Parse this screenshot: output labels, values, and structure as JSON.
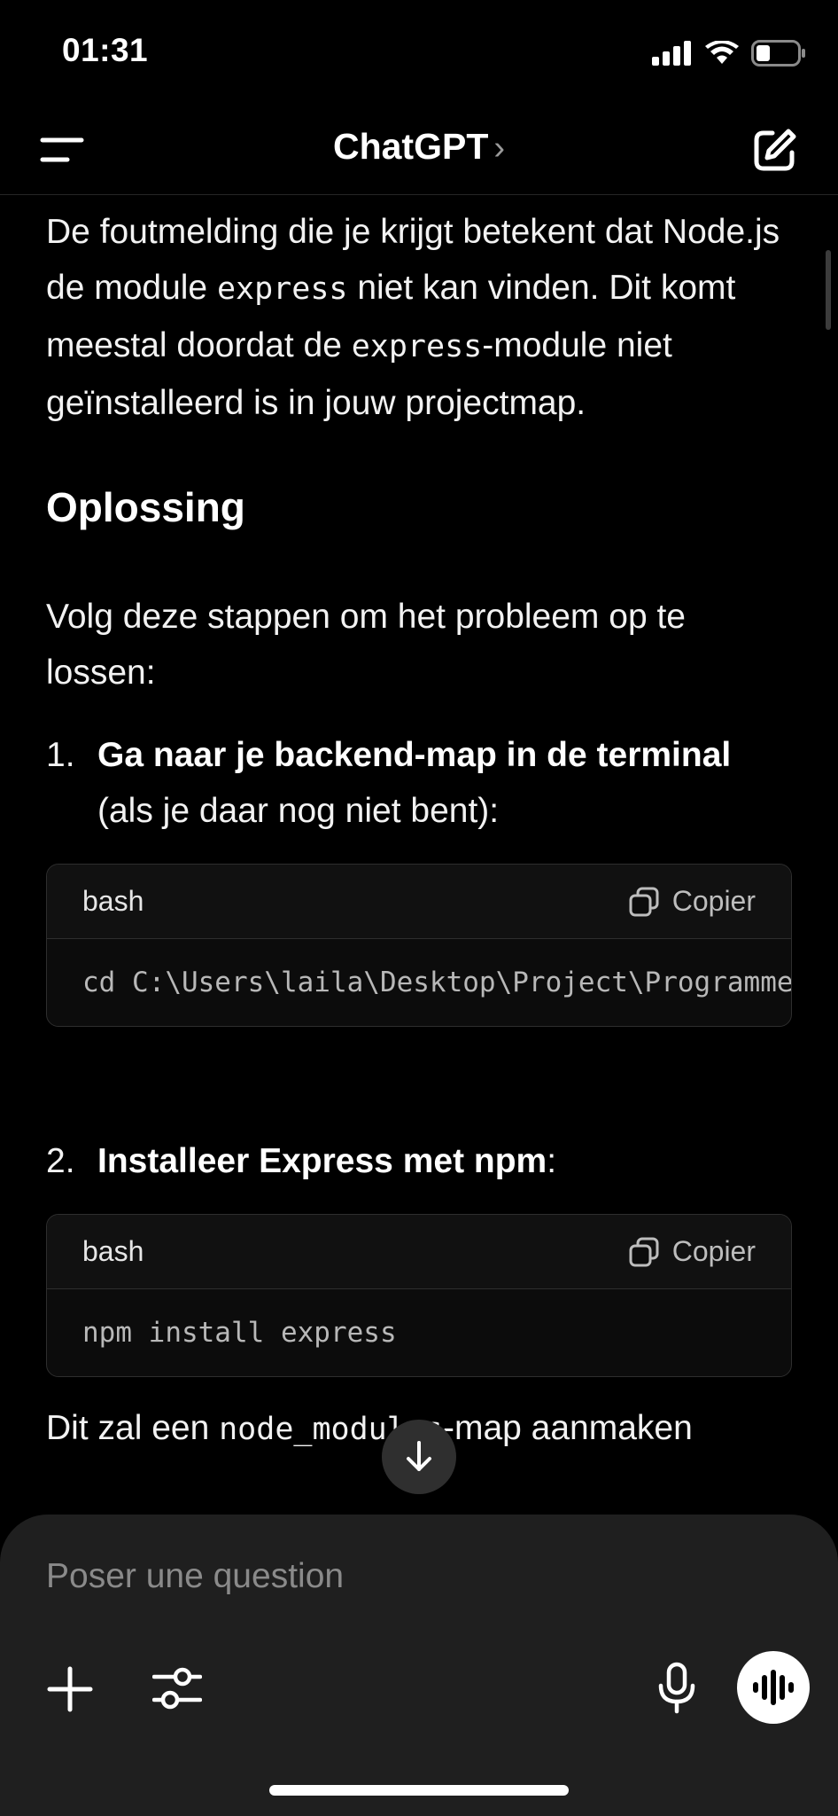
{
  "status_bar": {
    "time": "01:31",
    "icons": [
      "cellular-signal-icon",
      "wifi-icon",
      "battery-icon"
    ]
  },
  "header": {
    "title": "ChatGPT",
    "title_chevron": "›",
    "menu_icon": "menu-icon",
    "new_chat_icon": "compose-icon"
  },
  "message": {
    "intro": {
      "p1": "De foutmelding die je krijgt betekent dat Node.js de module ",
      "c1": "express",
      "p2": " niet kan vinden. Dit komt meestal doordat de ",
      "c2": "express",
      "p3": "-module niet geïnstalleerd is in jouw projectmap."
    },
    "heading": "Oplossing",
    "steps_intro": "Volg deze stappen om het probleem op te lossen:",
    "steps": [
      {
        "number": "1.",
        "bold": "Ga naar je backend-map in de terminal",
        "rest": " (als je daar nog niet bent):",
        "code": {
          "language": "bash",
          "copy_label": "Copier",
          "content": "cd C:\\Users\\laila\\Desktop\\Project\\Programmeren\\backend"
        }
      },
      {
        "number": "2.",
        "bold": "Installeer Express met npm",
        "rest": ":",
        "code": {
          "language": "bash",
          "copy_label": "Copier",
          "content": "npm install express"
        }
      }
    ],
    "after": {
      "p1": "Dit zal een ",
      "c1": "node_modules",
      "p2": "-map aanmaken"
    }
  },
  "composer": {
    "placeholder": "Poser une question",
    "buttons": [
      "plus-icon",
      "sliders-icon",
      "microphone-icon",
      "voice-mode-icon"
    ]
  },
  "colors": {
    "background": "#000000",
    "composer_bg": "#1f1f1f",
    "code_bg": "#0c0c0c",
    "border": "#2e2e2e",
    "muted_text": "#8a8a8a"
  }
}
